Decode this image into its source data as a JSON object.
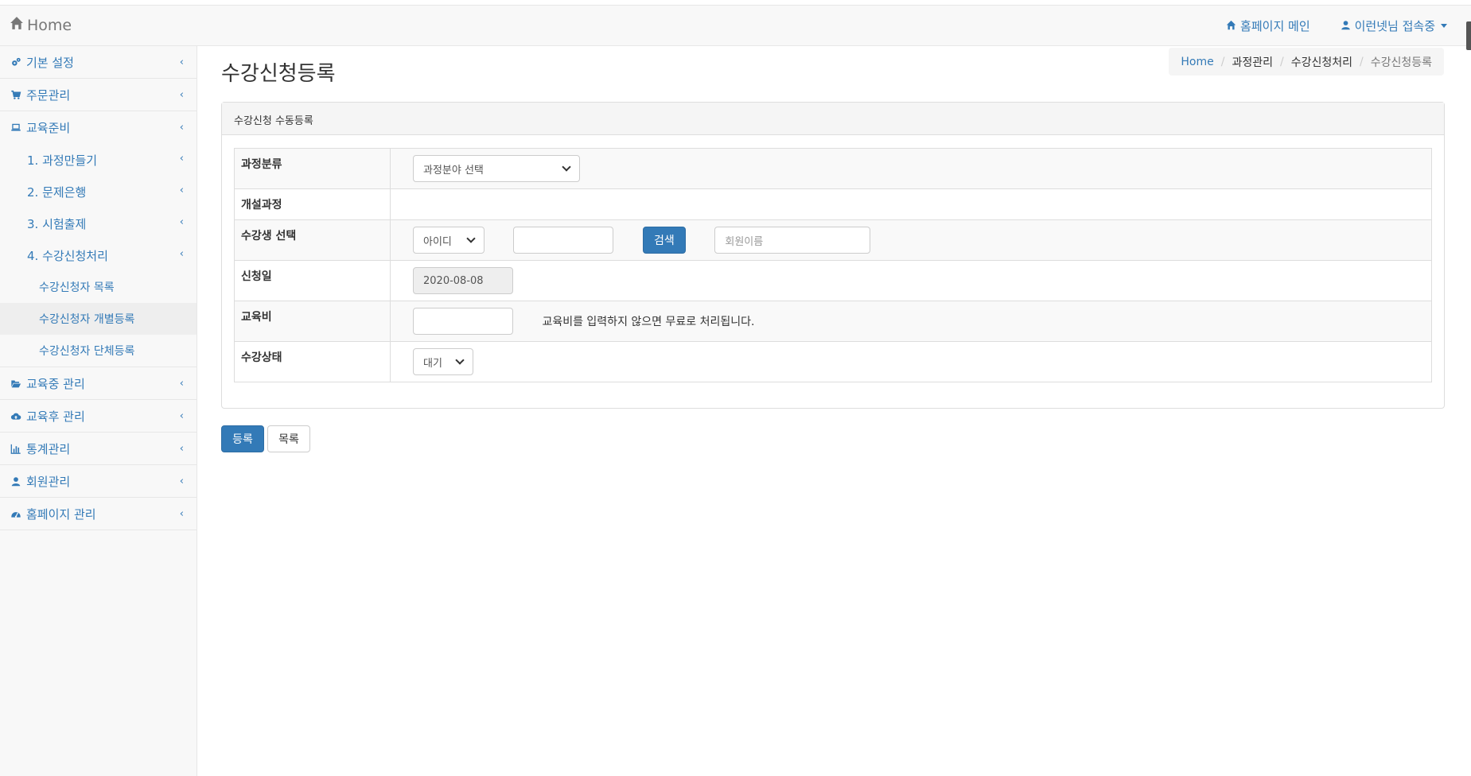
{
  "navbar": {
    "brand": "Home",
    "homepage_link": "홈페이지 메인",
    "user_menu": "이런넷님 접속중"
  },
  "sidebar": {
    "items": [
      {
        "label": "기본 설정",
        "icon": "gears-icon"
      },
      {
        "label": "주문관리",
        "icon": "cart-icon"
      },
      {
        "label": "교육준비",
        "icon": "laptop-icon"
      },
      {
        "label": "교육중 관리",
        "icon": "folder-open-icon"
      },
      {
        "label": "교육후 관리",
        "icon": "cloud-upload-icon"
      },
      {
        "label": "통계관리",
        "icon": "bar-chart-icon"
      },
      {
        "label": "회원관리",
        "icon": "user-icon"
      },
      {
        "label": "홈페이지 관리",
        "icon": "dashboard-icon"
      }
    ],
    "sub_items": [
      "1. 과정만들기",
      "2. 문제은행",
      "3. 시험출제",
      "4. 수강신청처리"
    ],
    "sub2_items": [
      "수강신청자 목록",
      "수강신청자 개별등록",
      "수강신청자 단체등록"
    ]
  },
  "page": {
    "title": "수강신청등록",
    "breadcrumb": [
      "Home",
      "과정관리",
      "수강신청처리",
      "수강신청등록"
    ]
  },
  "panel": {
    "heading": "수강신청 수동등록",
    "rows": {
      "category_label": "과정분류",
      "category_select": "과정분야 선택",
      "course_label": "개설과정",
      "student_label": "수강생 선택",
      "id_select": "아이디",
      "id_input_value": "",
      "search_button": "검색",
      "member_name_placeholder": "회원이름",
      "date_label": "신청일",
      "date_value": "2020-08-08",
      "fee_label": "교육비",
      "fee_value": "",
      "fee_help": "교육비를 입력하지 않으면 무료로 처리됩니다.",
      "status_label": "수강상태",
      "status_select": "대기"
    }
  },
  "actions": {
    "register": "등록",
    "list": "목록"
  }
}
